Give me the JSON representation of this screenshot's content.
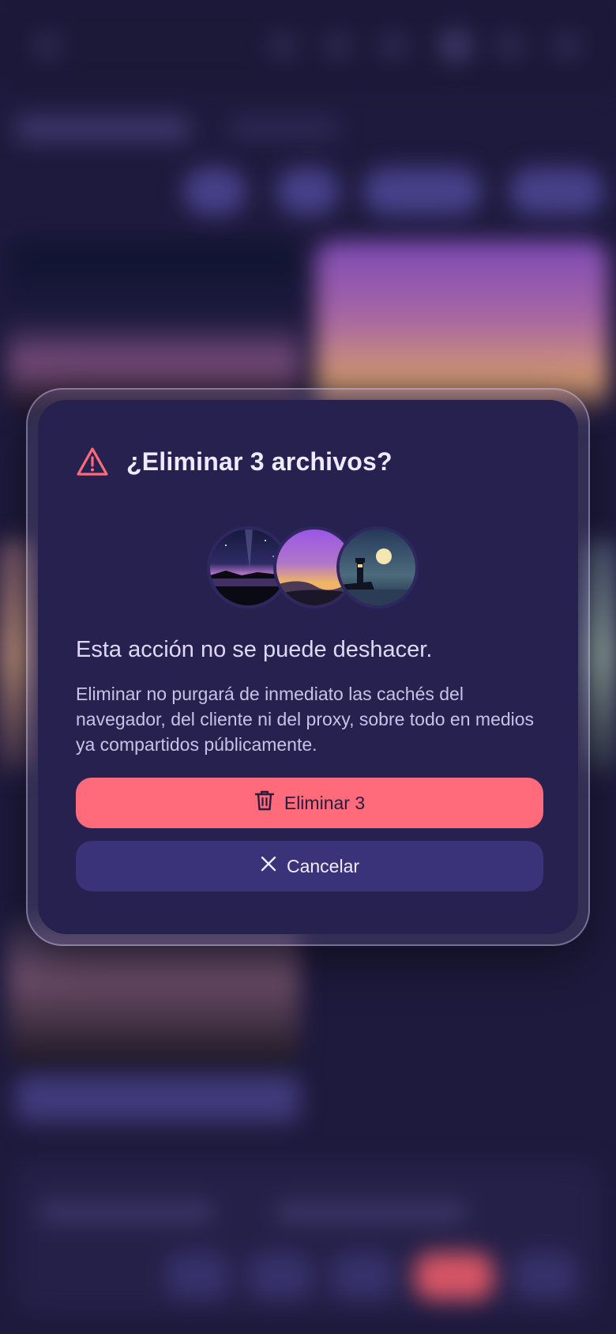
{
  "dialog": {
    "title": "¿Eliminar 3 archivos?",
    "heading": "Esta acción no se puede deshacer.",
    "body": "Eliminar no purgará de inmediato las cachés del navegador, del cliente ni del proxy, sobre todo en medios ya compartidos públicamente.",
    "confirm_label": "Eliminar 3",
    "cancel_label": "Cancelar",
    "thumbnails": [
      "night-lake-thumbnail",
      "sunset-hills-thumbnail",
      "lighthouse-moon-thumbnail"
    ]
  },
  "colors": {
    "danger": "#ff6b7a",
    "dialog_bg": "#272150",
    "secondary_button": "#3b3379",
    "page_bg": "#1e1a3d"
  }
}
